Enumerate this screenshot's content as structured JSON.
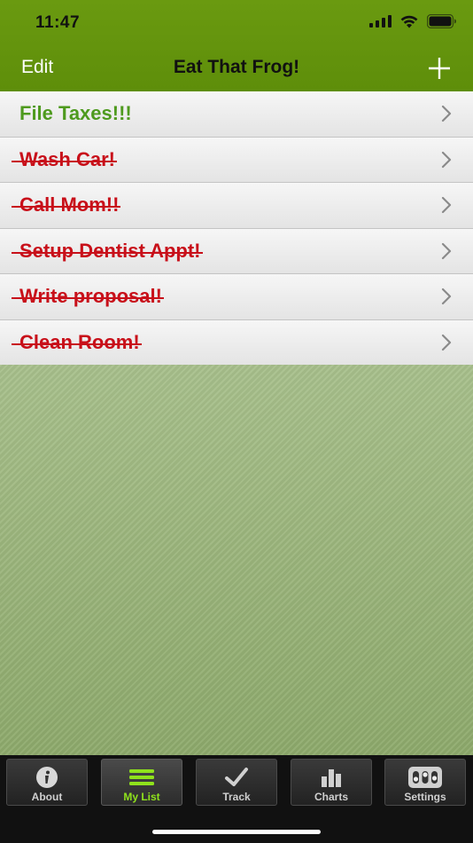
{
  "status_bar": {
    "time": "11:47"
  },
  "nav": {
    "edit_label": "Edit",
    "title": "Eat That Frog!",
    "add_icon": "plus-icon"
  },
  "tasks": [
    {
      "label": "File Taxes!!!",
      "done": false
    },
    {
      "label": "Wash Car!",
      "done": true
    },
    {
      "label": "Call Mom!!",
      "done": true
    },
    {
      "label": "Setup Dentist Appt!",
      "done": true
    },
    {
      "label": "Write proposal!",
      "done": true
    },
    {
      "label": "Clean Room!",
      "done": true
    }
  ],
  "tabbar": {
    "tabs": [
      {
        "label": "About",
        "icon": "info-icon",
        "selected": false
      },
      {
        "label": "My List",
        "icon": "list-icon",
        "selected": true
      },
      {
        "label": "Track",
        "icon": "checkmark-icon",
        "selected": false
      },
      {
        "label": "Charts",
        "icon": "bar-chart-icon",
        "selected": false
      },
      {
        "label": "Settings",
        "icon": "sliders-icon",
        "selected": false
      }
    ]
  },
  "colors": {
    "nav_green": "#6a9a10",
    "active_task": "#4e9a1e",
    "done_task": "#c8101a",
    "selected_tab_label": "#8fe21c"
  }
}
